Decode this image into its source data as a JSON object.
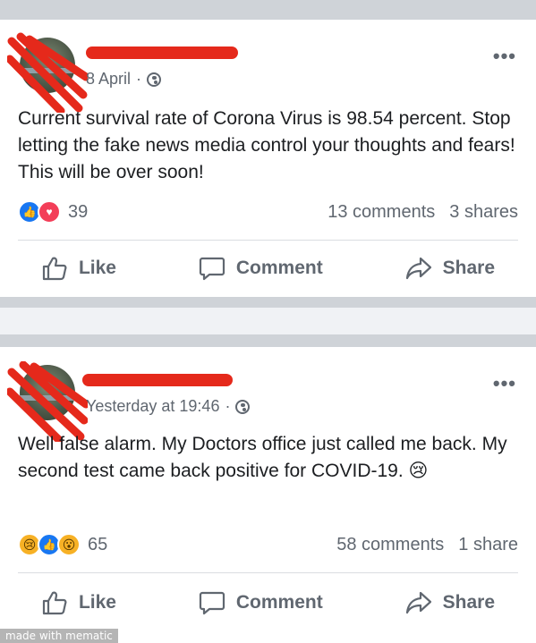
{
  "posts": [
    {
      "timestamp": "8 April",
      "separator": "·",
      "more": "•••",
      "text": "Current survival rate of Corona Virus is 98.54 percent. Stop letting the fake news media control your thoughts and fears! This will be over soon!",
      "reactions": [
        "like",
        "love"
      ],
      "reaction_count": "39",
      "comments": "13 comments",
      "shares": "3 shares",
      "actions": {
        "like": "Like",
        "comment": "Comment",
        "share": "Share"
      }
    },
    {
      "timestamp": "Yesterday at 19:46",
      "separator": "·",
      "more": "•••",
      "text": "Well false alarm. My Doctors office just called me back. My second test came back positive for COVID-19. 😢",
      "reactions": [
        "sad",
        "like",
        "wow"
      ],
      "reaction_count": "65",
      "comments": "58 comments",
      "shares": "1 share",
      "actions": {
        "like": "Like",
        "comment": "Comment",
        "share": "Share"
      }
    }
  ],
  "watermark": "made with mematic",
  "colors": {
    "separator": "#cfd3d8",
    "redaction": "#e5291b",
    "like_blue": "#1877f2",
    "love_red": "#f33e58",
    "secondary_text": "#606770"
  }
}
